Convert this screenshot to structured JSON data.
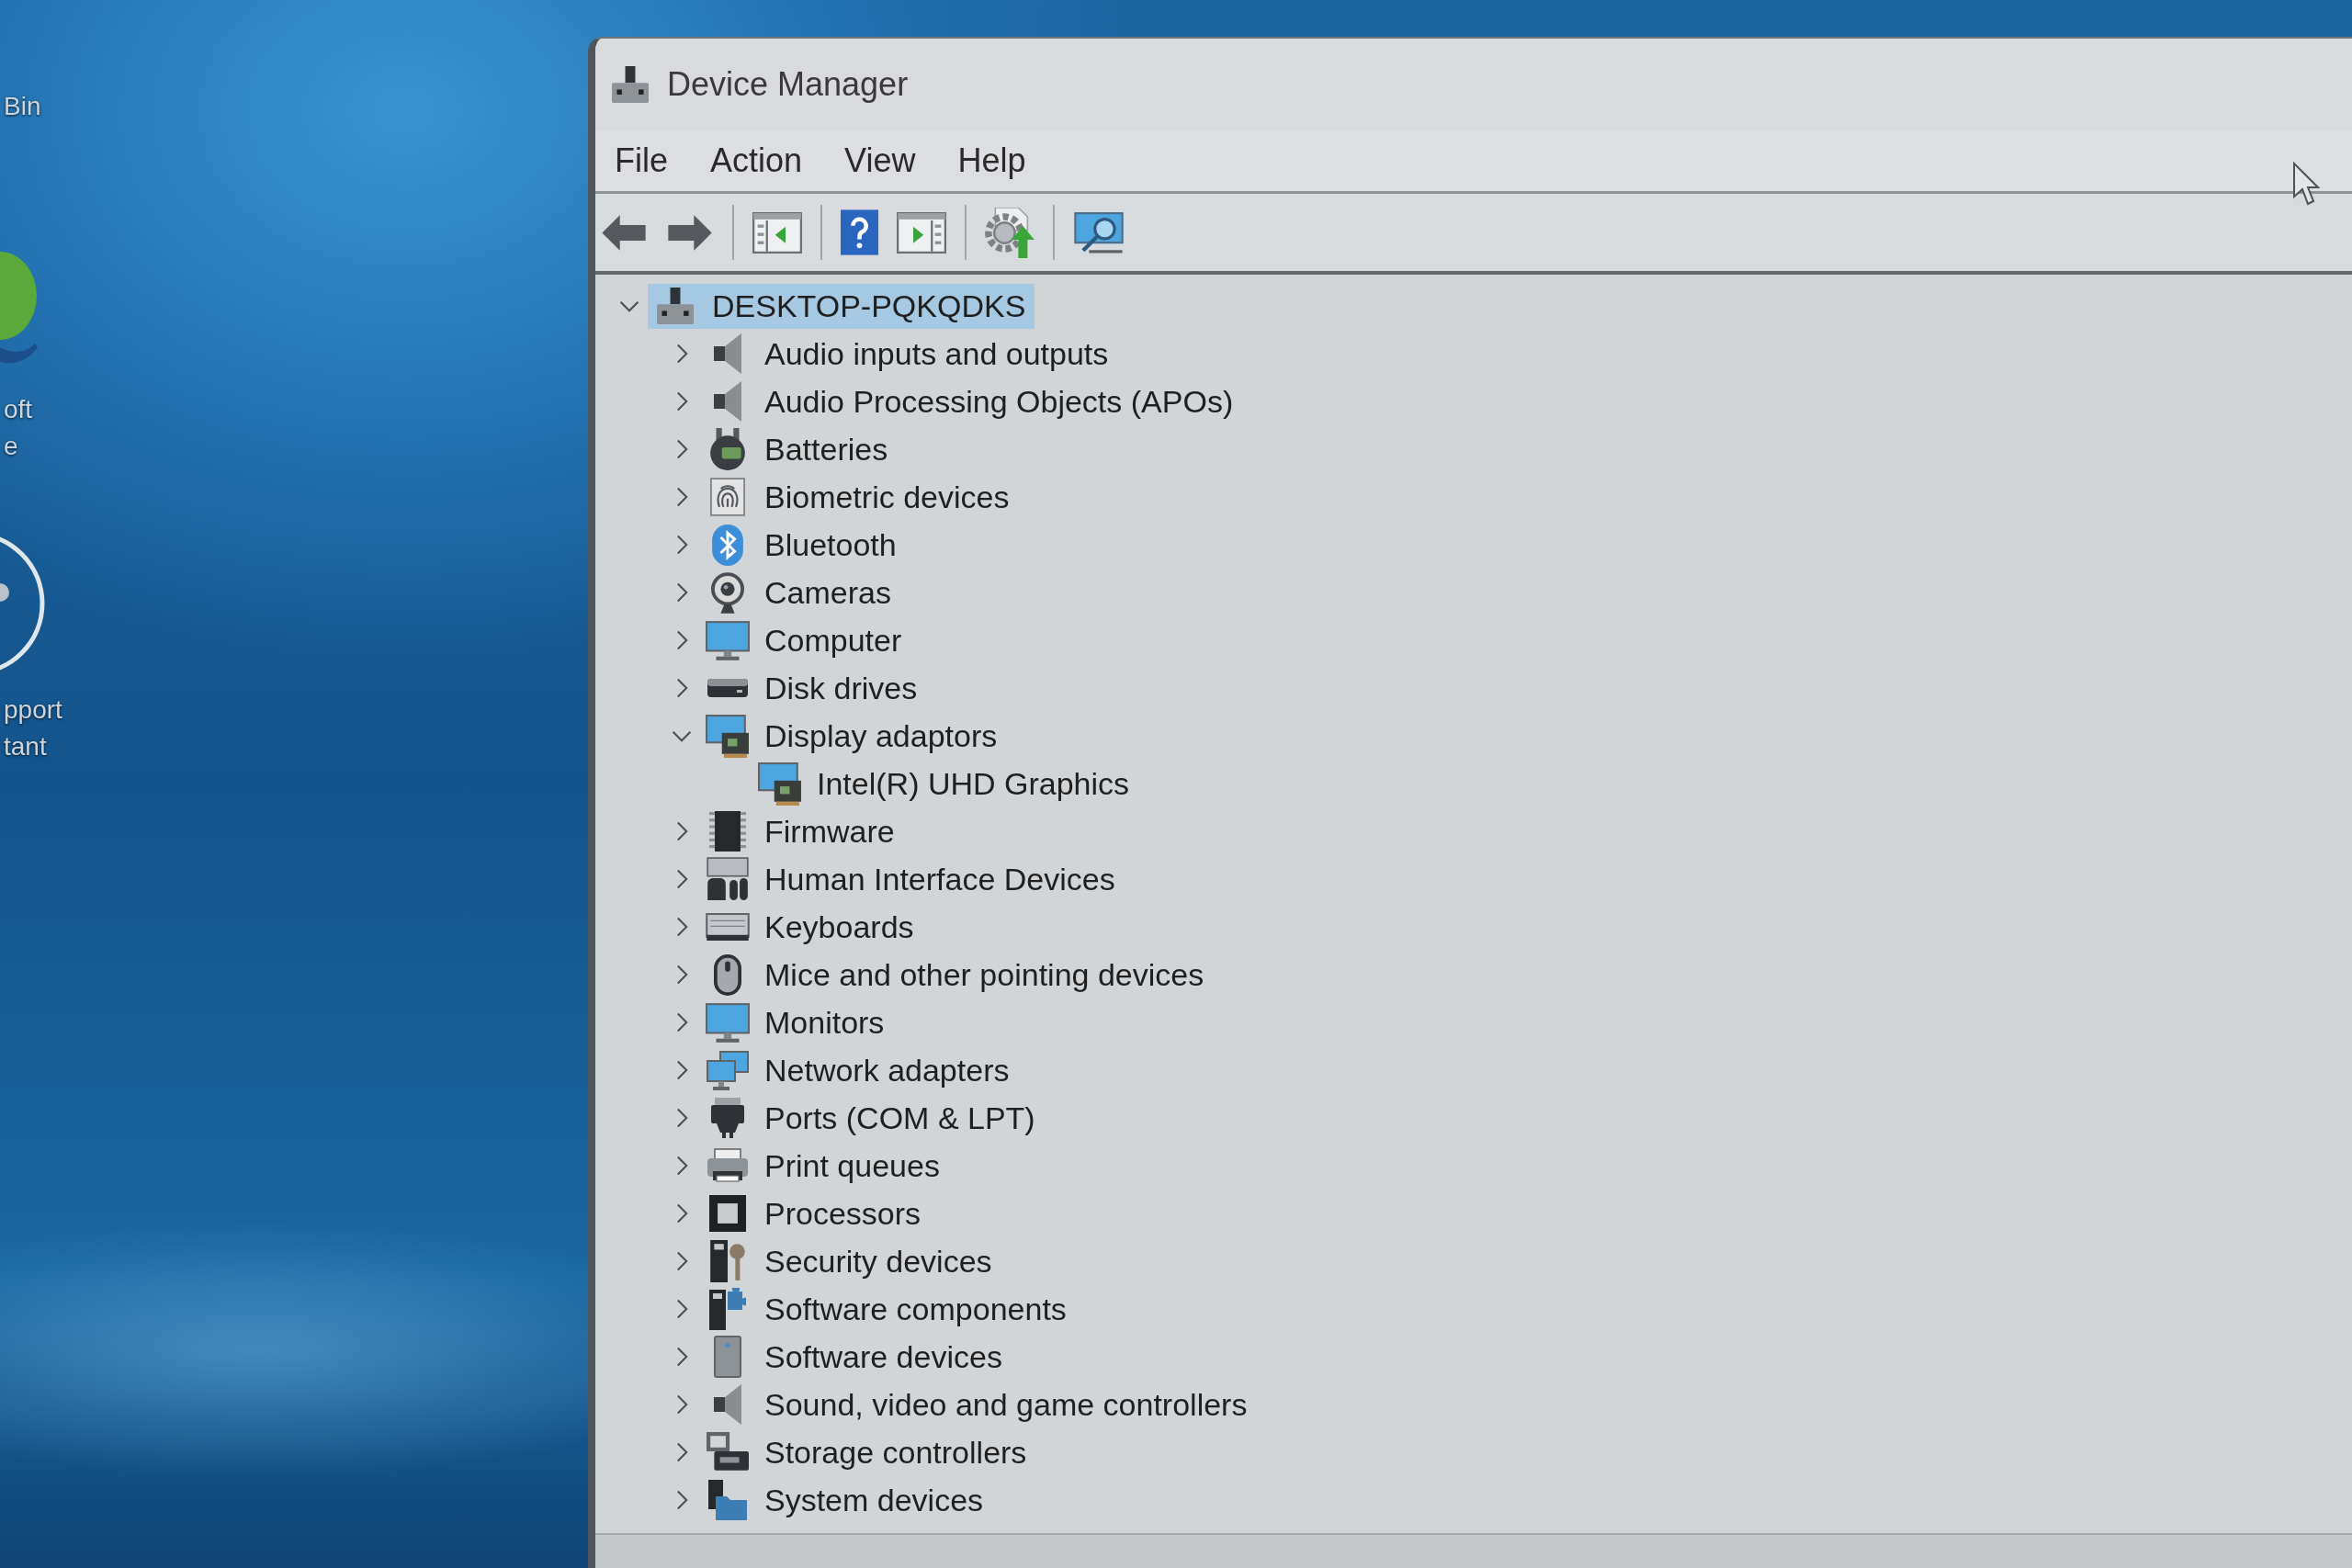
{
  "desktop_icons": [
    {
      "label_lines": [
        "Bin"
      ]
    },
    {
      "kind": "edge",
      "label_lines": [
        "oft",
        "e"
      ]
    },
    {
      "kind": "support",
      "label_lines": [
        "pport",
        "tant"
      ]
    }
  ],
  "window": {
    "title": "Device Manager"
  },
  "menu": [
    "File",
    "Action",
    "View",
    "Help"
  ],
  "tree": {
    "label": "DESKTOP-PQKQDKS",
    "kind": "host",
    "expanded": true,
    "selected": true,
    "children": [
      {
        "label": "Audio inputs and outputs",
        "kind": "speaker",
        "expanded": false,
        "selected": false
      },
      {
        "label": "Audio Processing Objects (APOs)",
        "kind": "speaker",
        "expanded": false,
        "selected": false
      },
      {
        "label": "Batteries",
        "kind": "battery",
        "expanded": false,
        "selected": false
      },
      {
        "label": "Biometric devices",
        "kind": "fingerprint",
        "expanded": false,
        "selected": false
      },
      {
        "label": "Bluetooth",
        "kind": "bluetooth",
        "expanded": false,
        "selected": false
      },
      {
        "label": "Cameras",
        "kind": "webcam",
        "expanded": false,
        "selected": false
      },
      {
        "label": "Computer",
        "kind": "monitor",
        "expanded": false,
        "selected": false
      },
      {
        "label": "Disk drives",
        "kind": "disk",
        "expanded": false,
        "selected": false
      },
      {
        "label": "Display adaptors",
        "kind": "display",
        "expanded": true,
        "selected": false,
        "children": [
          {
            "label": "Intel(R) UHD Graphics",
            "kind": "display",
            "selected": false
          }
        ]
      },
      {
        "label": "Firmware",
        "kind": "chip",
        "expanded": false,
        "selected": false
      },
      {
        "label": "Human Interface Devices",
        "kind": "hid",
        "expanded": false,
        "selected": false
      },
      {
        "label": "Keyboards",
        "kind": "keyboard",
        "expanded": false,
        "selected": false
      },
      {
        "label": "Mice and other pointing devices",
        "kind": "mouse",
        "expanded": false,
        "selected": false
      },
      {
        "label": "Monitors",
        "kind": "monitor",
        "expanded": false,
        "selected": false
      },
      {
        "label": "Network adapters",
        "kind": "network",
        "expanded": false,
        "selected": false
      },
      {
        "label": "Ports (COM & LPT)",
        "kind": "port",
        "expanded": false,
        "selected": false
      },
      {
        "label": "Print queues",
        "kind": "printer",
        "expanded": false,
        "selected": false
      },
      {
        "label": "Processors",
        "kind": "processor",
        "expanded": false,
        "selected": false
      },
      {
        "label": "Security devices",
        "kind": "security",
        "expanded": false,
        "selected": false
      },
      {
        "label": "Software components",
        "kind": "component",
        "expanded": false,
        "selected": false
      },
      {
        "label": "Software devices",
        "kind": "tower",
        "expanded": false,
        "selected": false
      },
      {
        "label": "Sound, video and game controllers",
        "kind": "speaker",
        "expanded": false,
        "selected": false
      },
      {
        "label": "Storage controllers",
        "kind": "storage",
        "expanded": false,
        "selected": false
      },
      {
        "label": "System devices",
        "kind": "system",
        "expanded": false,
        "selected": false
      }
    ]
  }
}
